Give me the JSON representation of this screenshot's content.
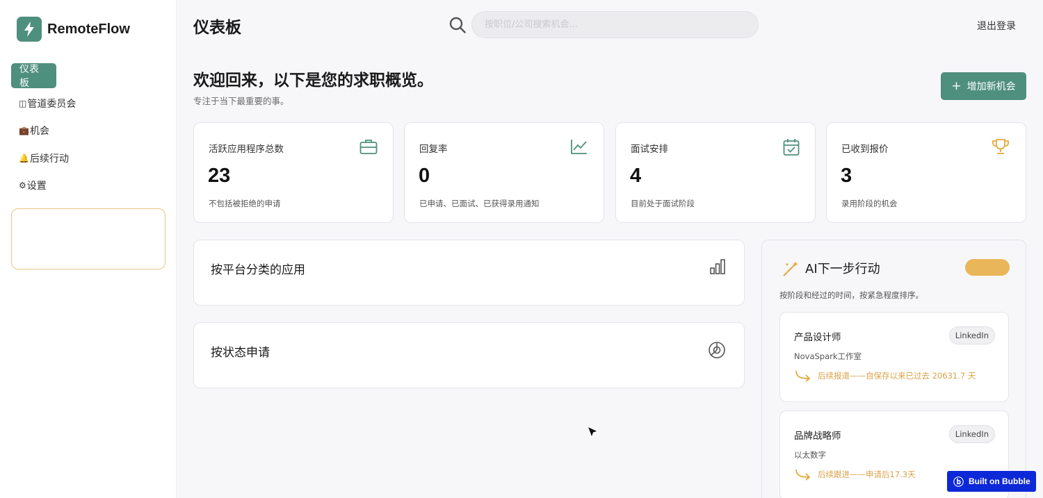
{
  "brand": {
    "name": "RemoteFlow"
  },
  "sidebar": {
    "items": [
      {
        "label": "仪表板",
        "icon": ""
      },
      {
        "label": "管道委员会",
        "icon": "◫"
      },
      {
        "label": "机会",
        "icon": "💼"
      },
      {
        "label": "后续行动",
        "icon": "🔔"
      },
      {
        "label": "设置",
        "icon": "⚙"
      }
    ]
  },
  "header": {
    "title": "仪表板",
    "search_placeholder": "按职位/公司搜索机会...",
    "logout": "退出登录"
  },
  "welcome": {
    "title": "欢迎回来，以下是您的求职概览。",
    "subtitle": "专注于当下最重要的事。",
    "add_button": "增加新机会"
  },
  "stats": [
    {
      "label": "活跃应用程序总数",
      "value": "23",
      "desc": "不包括被拒绝的申请",
      "icon": "briefcase-icon"
    },
    {
      "label": "回复率",
      "value": "0",
      "desc": "已申请、已面试、已获得录用通知",
      "icon": "trend-chart-icon"
    },
    {
      "label": "面试安排",
      "value": "4",
      "desc": "目前处于面试阶段",
      "icon": "calendar-check-icon"
    },
    {
      "label": "已收到报价",
      "value": "3",
      "desc": "录用阶段的机会",
      "icon": "trophy-icon"
    }
  ],
  "panels": {
    "by_platform": "按平台分类的应用",
    "by_status": "按状态申请"
  },
  "ai": {
    "title": "AI下一步行动",
    "subtitle": "按阶段和经过的时间，按紧急程度排序。",
    "actions": [
      {
        "role": "产品设计师",
        "platform": "LinkedIn",
        "company": "NovaSpark工作室",
        "followup": "后续报道——自保存以来已过去 20631.7 天"
      },
      {
        "role": "品牌战略师",
        "platform": "LinkedIn",
        "company": "以太数字",
        "followup": "后续跟进——申请后17.3天"
      }
    ]
  },
  "footer": {
    "bubble": "Built on Bubble"
  },
  "colors": {
    "accent": "#4f8f7d",
    "gold": "#e2a93b",
    "bubble_blue": "#0d28d6"
  }
}
